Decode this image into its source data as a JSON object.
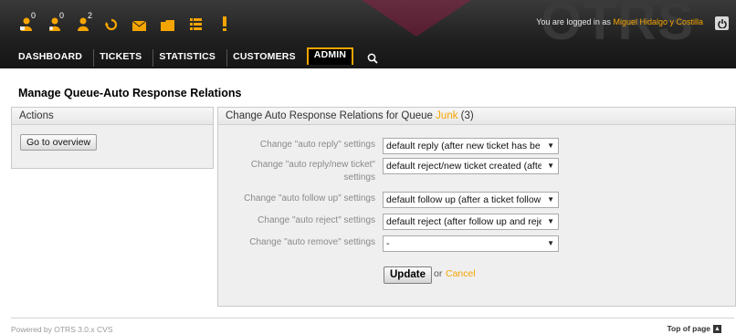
{
  "header": {
    "logo_text": "OTRS",
    "login_prefix": "You are logged in as",
    "user_name": "Miguel Hidalgo y Costilla",
    "toolbar": [
      {
        "icon": "locked-tickets-icon",
        "count": "0"
      },
      {
        "icon": "watched-tickets-icon",
        "count": "0"
      },
      {
        "icon": "responsible-tickets-icon",
        "count": "2"
      },
      {
        "icon": "refresh-icon",
        "count": ""
      },
      {
        "icon": "new-email-icon",
        "count": ""
      },
      {
        "icon": "folder-icon",
        "count": ""
      },
      {
        "icon": "queue-view-icon",
        "count": ""
      },
      {
        "icon": "escalation-icon",
        "count": ""
      }
    ],
    "nav": [
      "DASHBOARD",
      "TICKETS",
      "STATISTICS",
      "CUSTOMERS",
      "ADMIN"
    ],
    "active_nav": "ADMIN"
  },
  "page": {
    "title": "Manage Queue-Auto Response Relations"
  },
  "actions": {
    "heading": "Actions",
    "go_to_overview": "Go to overview"
  },
  "main": {
    "heading_prefix": "Change Auto Response Relations for Queue",
    "queue_name": "Junk",
    "queue_id_suffix": "(3)",
    "settings": [
      {
        "label": "Change \"auto reply\" settings",
        "value": "default reply (after new ticket has be"
      },
      {
        "label": "Change \"auto reply/new ticket\" settings",
        "value": "default reject/new ticket created (afte"
      },
      {
        "label": "Change \"auto follow up\" settings",
        "value": "default follow up (after a ticket follow"
      },
      {
        "label": "Change \"auto reject\" settings",
        "value": "default reject (after follow up and reje"
      },
      {
        "label": "Change \"auto remove\" settings",
        "value": "-"
      }
    ],
    "update_label": "Update",
    "or_text": "or",
    "cancel_label": "Cancel"
  },
  "footer": {
    "powered_by": "Powered by OTRS 3.0.x CVS",
    "top_of_page": "Top of page"
  },
  "colors": {
    "accent": "#f6a500",
    "header_bg": "#1f1f1f",
    "box_bg": "#efefef",
    "label_gray": "#8a8a8a"
  }
}
